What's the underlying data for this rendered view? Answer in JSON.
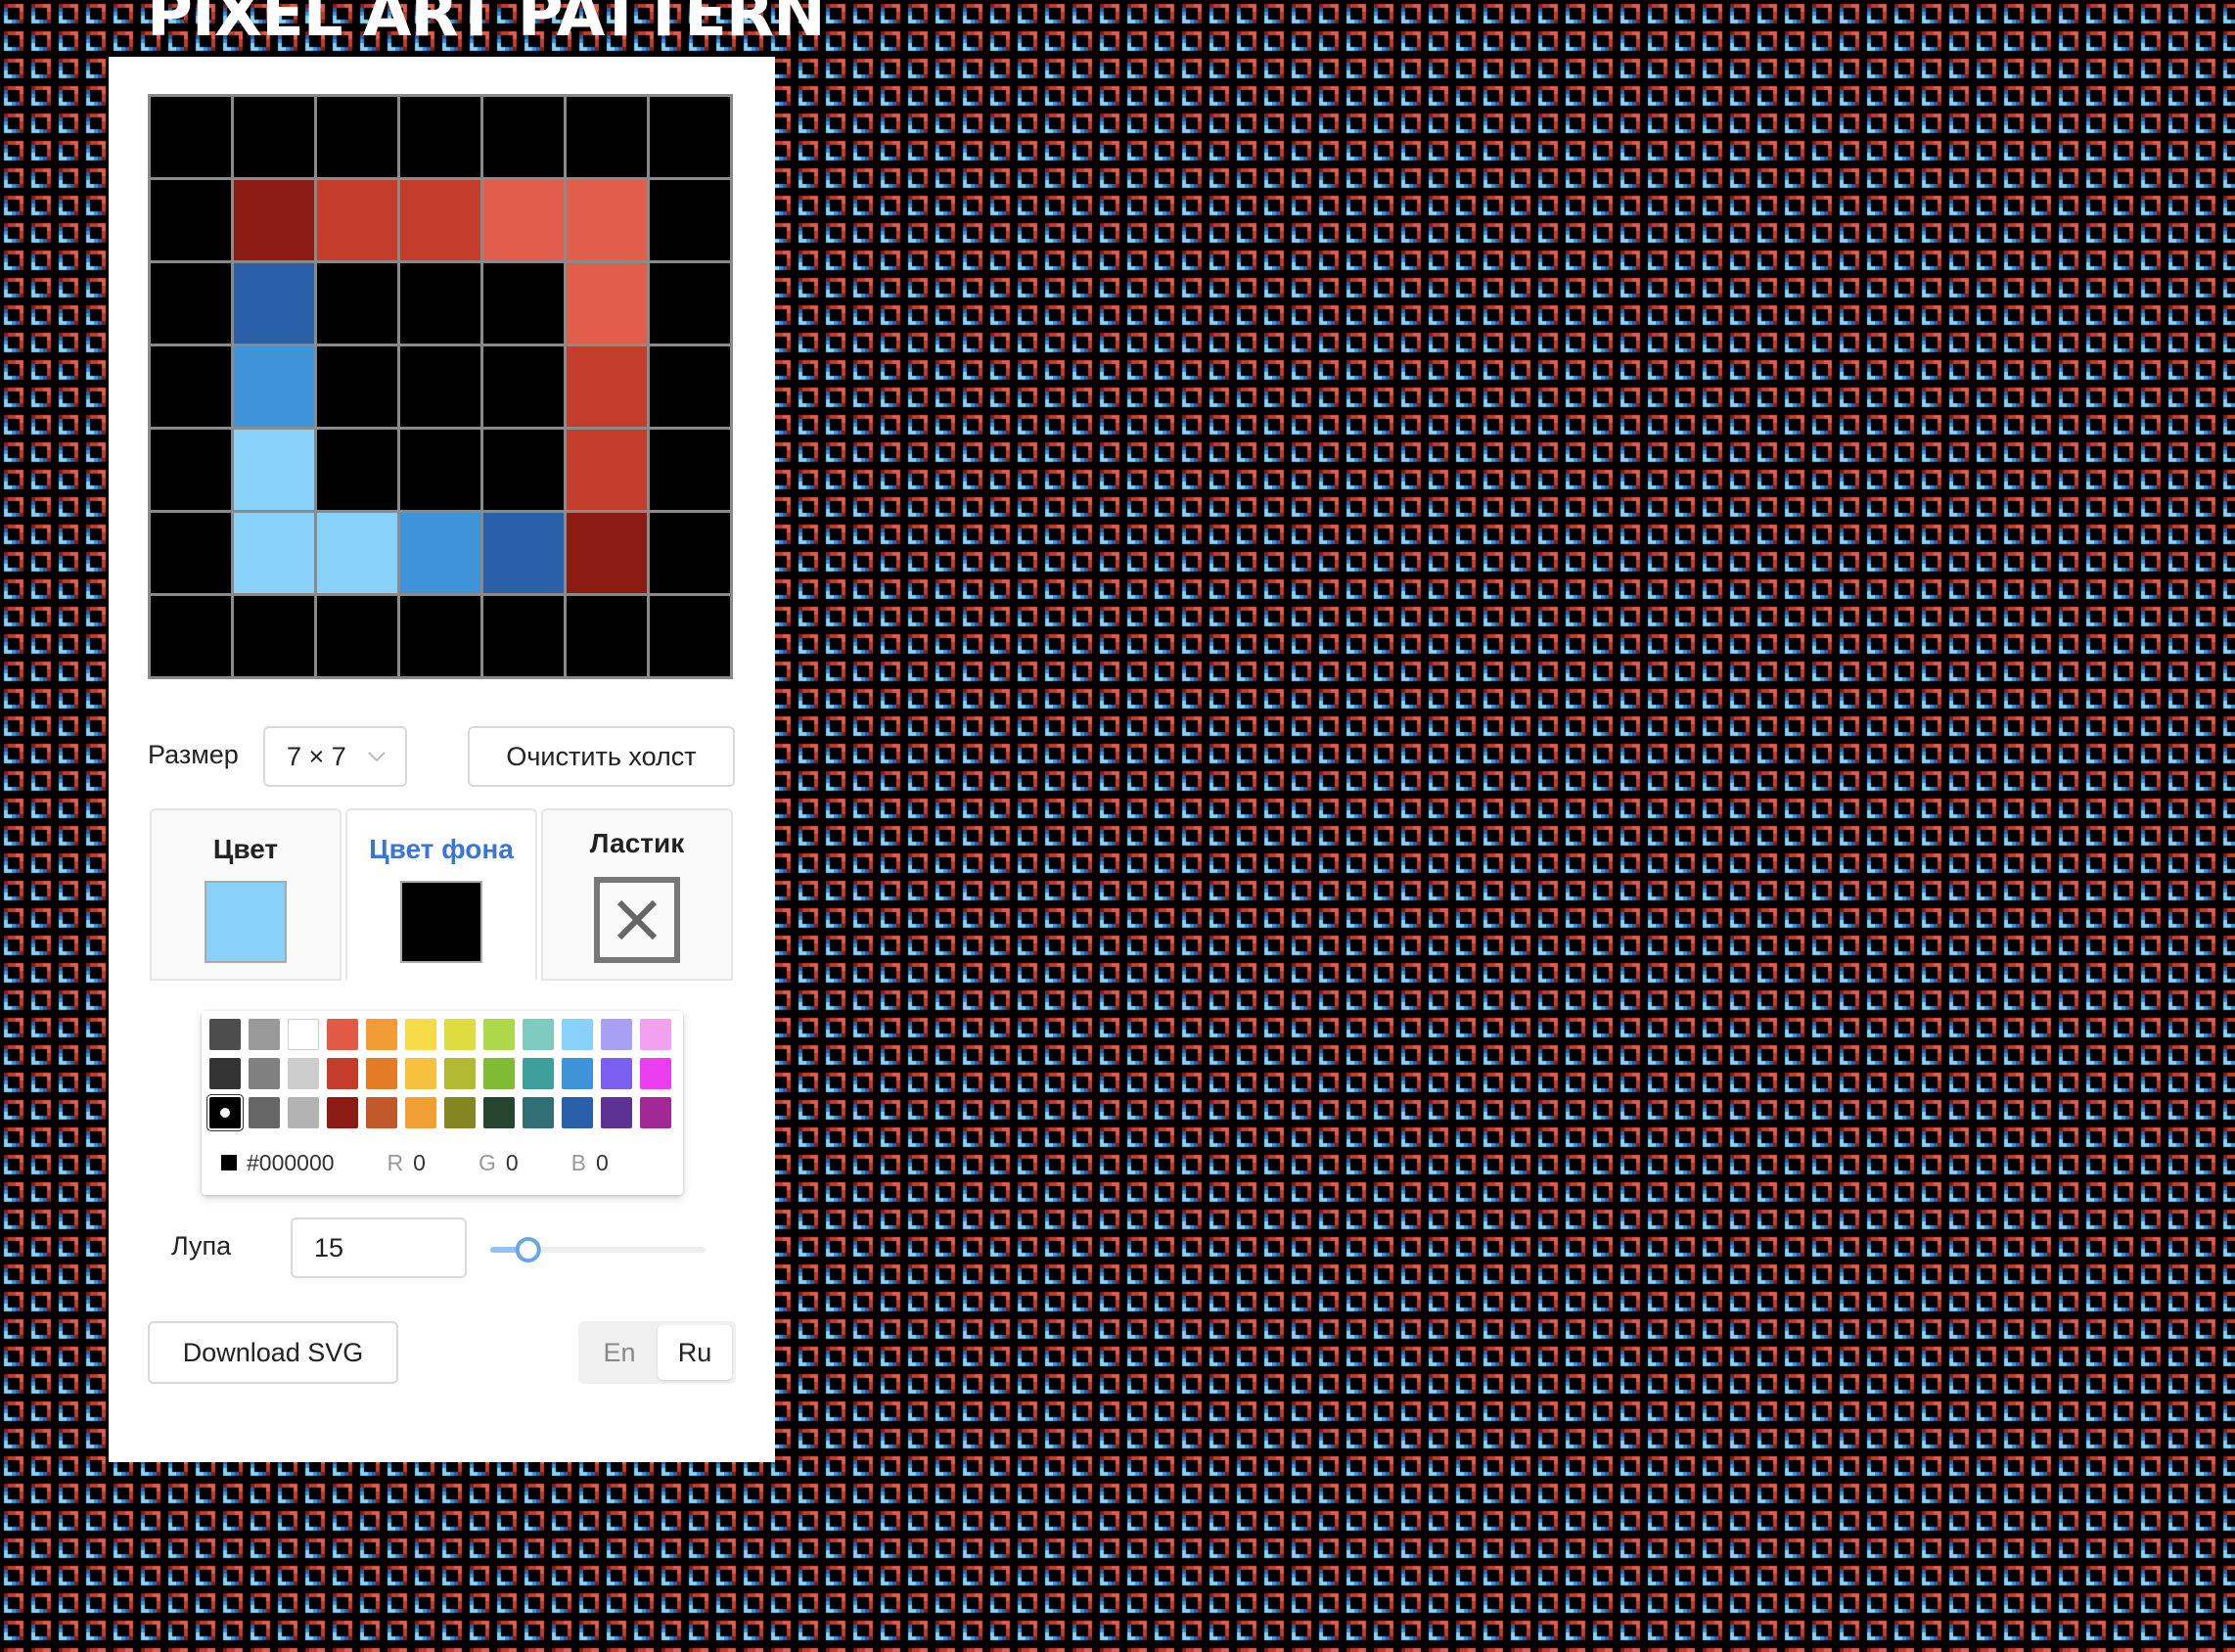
{
  "app": {
    "title": "PIXEL ART PATTERN"
  },
  "canvas": {
    "size": 7,
    "pixels": [
      [
        "#000000",
        "#000000",
        "#000000",
        "#000000",
        "#000000",
        "#000000",
        "#000000"
      ],
      [
        "#000000",
        "#8c1c13",
        "#c43d2a",
        "#c43d2a",
        "#e35d4b",
        "#e35d4b",
        "#000000"
      ],
      [
        "#000000",
        "#2a5faa",
        "#000000",
        "#000000",
        "#000000",
        "#e35d4b",
        "#000000"
      ],
      [
        "#000000",
        "#3f93d8",
        "#000000",
        "#000000",
        "#000000",
        "#c43d2a",
        "#000000"
      ],
      [
        "#000000",
        "#87d1fa",
        "#000000",
        "#000000",
        "#000000",
        "#c43d2a",
        "#000000"
      ],
      [
        "#000000",
        "#87d1fa",
        "#87d1fa",
        "#3f93d8",
        "#2a5faa",
        "#8c1c13",
        "#000000"
      ],
      [
        "#000000",
        "#000000",
        "#000000",
        "#000000",
        "#000000",
        "#000000",
        "#000000"
      ]
    ]
  },
  "controls": {
    "size_label": "Размер",
    "size_value": "7 × 7",
    "clear_button": "Очистить холст"
  },
  "tabs": {
    "color": {
      "label": "Цвет",
      "value": "#87d1fa"
    },
    "background": {
      "label": "Цвет фона",
      "value": "#000000",
      "active": true
    },
    "eraser": {
      "label": "Ластик"
    }
  },
  "palette": {
    "colors": [
      [
        "#4d4d4d",
        "#999999",
        "#ffffff",
        "#e25a45",
        "#f19c35",
        "#f7dc48",
        "#dddd3f",
        "#acd84a",
        "#7fcac1",
        "#87d1fa",
        "#a7a0f3",
        "#f2a1f1"
      ],
      [
        "#333333",
        "#808080",
        "#cccccc",
        "#c43d2a",
        "#e47b26",
        "#f6c23d",
        "#b1ba31",
        "#80bb36",
        "#3f9f9c",
        "#3f93d8",
        "#7a5ff0",
        "#eb3ef0"
      ],
      [
        "#000000",
        "#666666",
        "#b3b3b3",
        "#8c1c13",
        "#c2592b",
        "#f0a033",
        "#848621",
        "#25452e",
        "#2f6f75",
        "#2a5faa",
        "#5d3294",
        "#a22895"
      ]
    ],
    "selected": "#000000",
    "hex": "#000000",
    "r_label": "R",
    "r": "0",
    "g_label": "G",
    "g": "0",
    "b_label": "B",
    "b": "0"
  },
  "zoom": {
    "label": "Лупа",
    "value": "15",
    "slider_fraction": 0.14
  },
  "download": {
    "label": "Download SVG"
  },
  "language": {
    "en": "En",
    "ru": "Ru",
    "selected": "Ru"
  },
  "pattern": {
    "bg": "#000000",
    "colors": [
      "#e35d4b",
      "#87d1fa"
    ]
  }
}
